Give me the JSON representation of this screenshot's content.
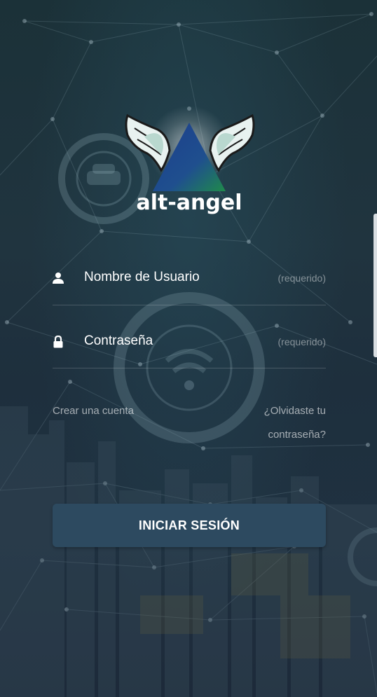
{
  "brand": {
    "name": "alt-angel"
  },
  "form": {
    "username": {
      "label": "Nombre de Usuario",
      "hint": "(requerido)",
      "icon": "user-icon"
    },
    "password": {
      "label": "Contraseña",
      "hint": "(requerido)",
      "icon": "lock-icon"
    },
    "create_account": "Crear una cuenta",
    "forgot_password_line1": "¿Olvidaste tu",
    "forgot_password_line2": "contraseña?",
    "login_button": "INICIAR SESIÓN"
  },
  "colors": {
    "background": "#1c2e39",
    "button": "#2d4a60",
    "text": "#ffffff",
    "muted_text": "#9aa5ad"
  }
}
